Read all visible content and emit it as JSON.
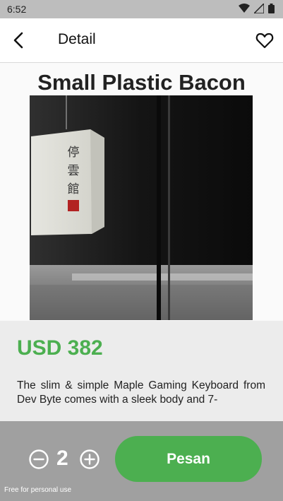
{
  "status_bar": {
    "time": "6:52",
    "icons": [
      "wifi-icon",
      "signal-icon",
      "battery-icon"
    ]
  },
  "app_bar": {
    "title": "Detail",
    "back_icon": "back-arrow-icon",
    "favorite_icon": "heart-outline-icon"
  },
  "product": {
    "name": "Small Plastic Bacon",
    "price": "USD 382",
    "description": "The slim & simple Maple Gaming Keyboard from Dev Byte comes with a sleek body and 7-"
  },
  "bottom_bar": {
    "quantity": "2",
    "order_label": "Pesan",
    "watermark": "Free for personal use"
  },
  "colors": {
    "accent": "#4caf50",
    "bottom_bar": "#a0a0a0",
    "status_bar": "#bdbdbd"
  }
}
